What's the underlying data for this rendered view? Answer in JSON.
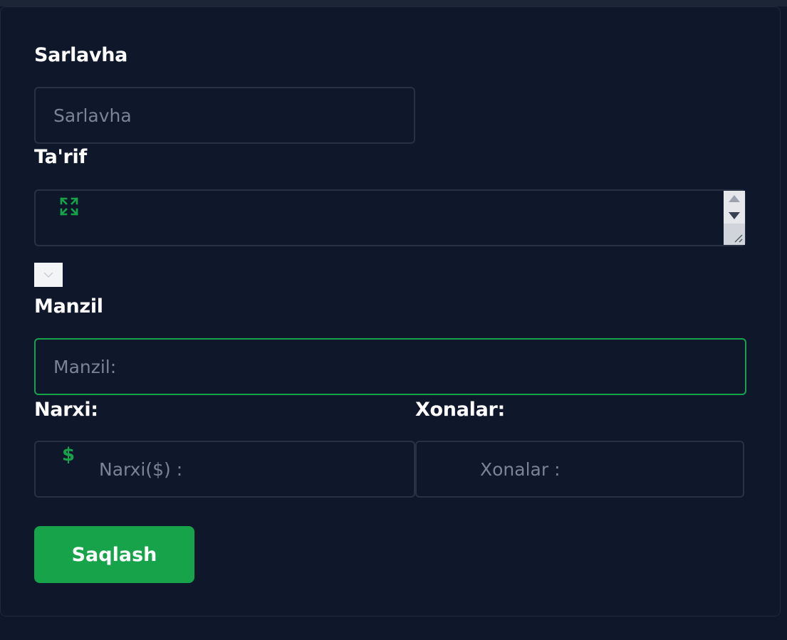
{
  "form": {
    "title_label": "Sarlavha",
    "title_placeholder": "Sarlavha",
    "description_label": "Ta'rif",
    "address_label": "Manzil",
    "address_placeholder": "Manzil:",
    "price_label": "Narxi:",
    "price_icon": "$",
    "price_placeholder": "Narxi($) :",
    "rooms_label": "Xonalar:",
    "rooms_placeholder": "Xonalar :",
    "save_label": "Saqlash"
  },
  "icons": {
    "description_expand": "expand-icon",
    "toggle": "chevron-down-icon",
    "price": "dollar-icon"
  },
  "colors": {
    "accent": "#16a34a",
    "background": "#0f182a",
    "border": "#283244",
    "text": "#ffffff",
    "placeholder": "#7b8494"
  }
}
